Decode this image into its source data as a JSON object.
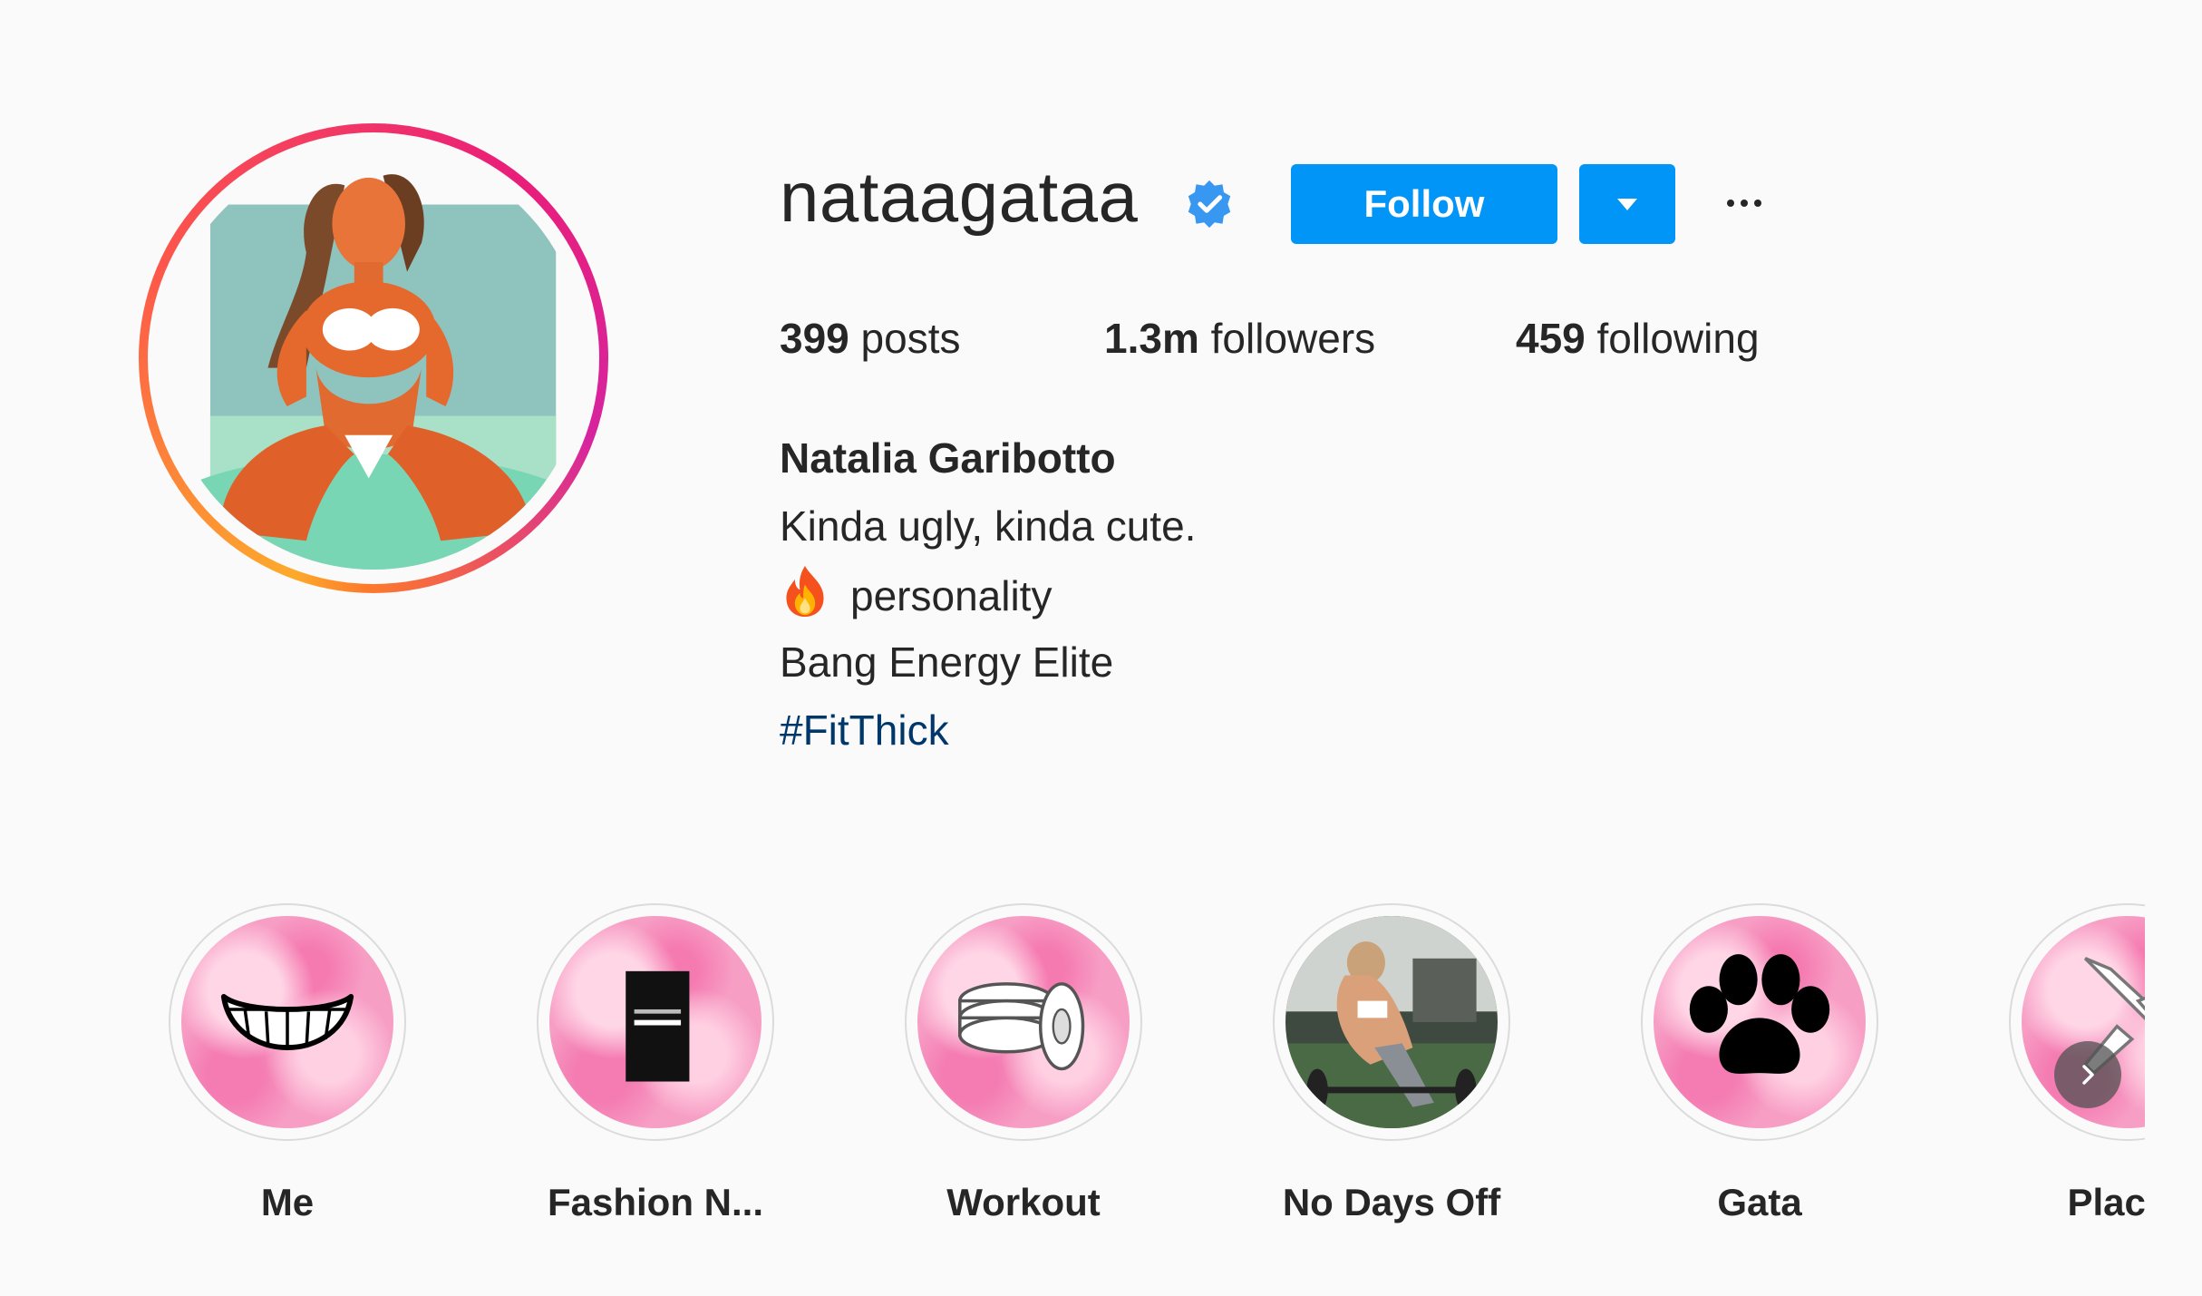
{
  "profile": {
    "username": "nataagataa",
    "verified": true,
    "follow_label": "Follow",
    "stats": {
      "posts_count": "399",
      "posts_label": "posts",
      "followers_count": "1.3m",
      "followers_label": "followers",
      "following_count": "459",
      "following_label": "following"
    },
    "bio": {
      "full_name": "Natalia Garibotto",
      "line1": "Kinda ugly, kinda cute.",
      "line2_text": "personality",
      "line2_emoji": "fire-icon",
      "line3": "Bang Energy Elite",
      "hashtag": "#FitThick"
    }
  },
  "highlights": [
    {
      "label": "Me",
      "icon": "smile-icon"
    },
    {
      "label": "Fashion N...",
      "icon": "fashion-nova-book-icon"
    },
    {
      "label": "Workout",
      "icon": "weight-plates-icon"
    },
    {
      "label": "No Days Off",
      "icon": "photo"
    },
    {
      "label": "Gata",
      "icon": "paw-icon"
    },
    {
      "label": "Places",
      "icon": "airplane-icon"
    }
  ],
  "colors": {
    "primary_button": "#0095f6",
    "hashtag": "#00376b",
    "text": "#262626",
    "background": "#fafafa"
  }
}
